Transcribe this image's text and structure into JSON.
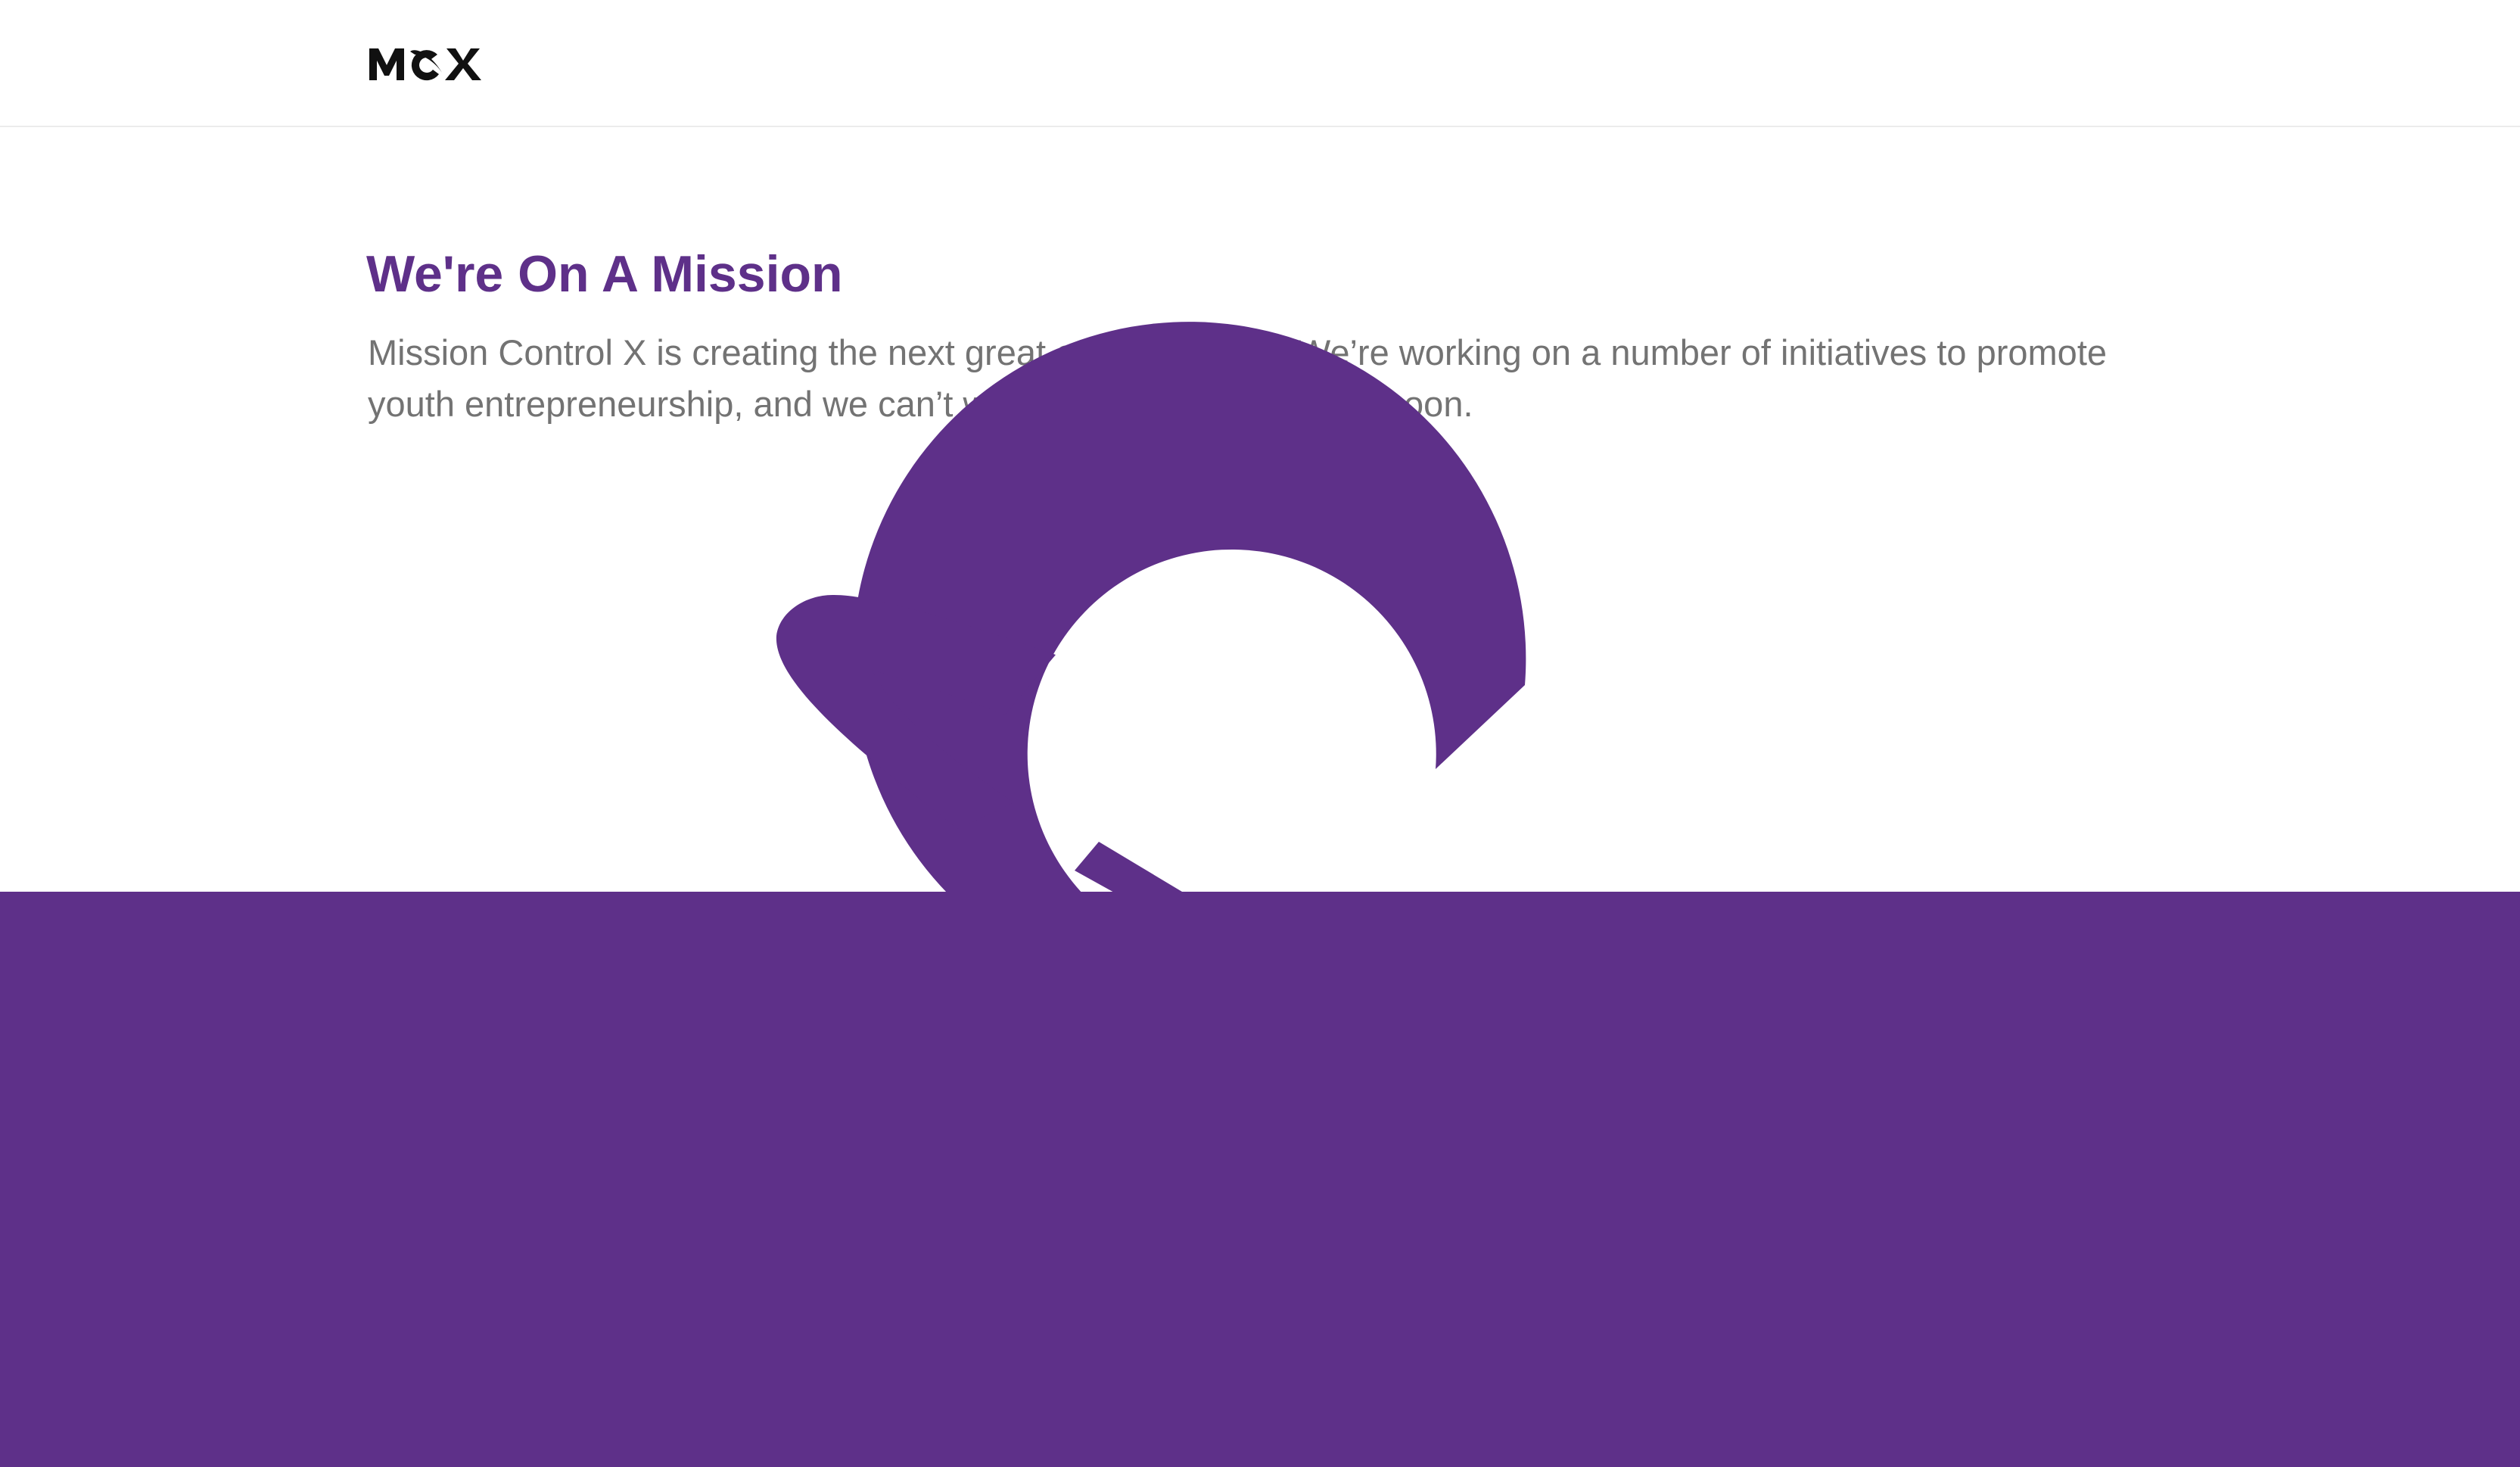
{
  "header": {
    "logo_text": "MCX",
    "logo_icon": "mcx-rocket-logo"
  },
  "main": {
    "title": "We're On A Mission",
    "description": "Mission Control X is creating the next great entrepreneurs. We’re working on a number of initiatives to promote youth entrepreneurship, and we can’t wait to tell you about them soon."
  },
  "hero": {
    "graphic_icon": "mcx-c-orbit-mark"
  },
  "colors": {
    "brand_purple": "#5e3089",
    "body_text": "#737373",
    "header_border": "#ececec",
    "logo": "#111111"
  }
}
